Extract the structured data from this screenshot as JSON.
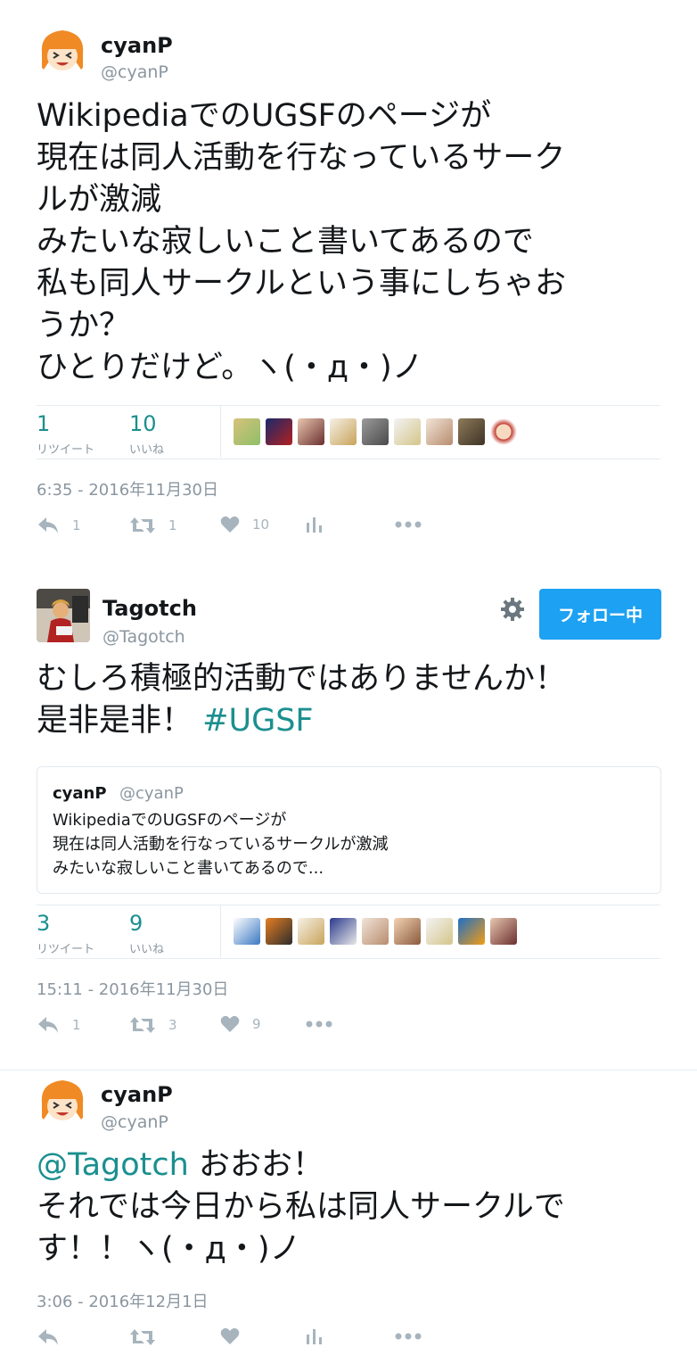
{
  "tweets": [
    {
      "name": "cyanP",
      "handle": "@cyanP",
      "body": "WikipediaでのUGSFのページが\n現在は同人活動を行なっているサーク\nルが激減\nみたいな寂しいこと書いてあるので\n私も同人サークルという事にしちゃお\nうか？\nひとりだけど。ヽ(・д・)ノ",
      "retweets_count": "1",
      "retweets_label": "リツイート",
      "likes_count": "10",
      "likes_label": "いいね",
      "timestamp": "6:35 - 2016年11月30日",
      "reply_count": "1",
      "retweet_count_action": "1",
      "like_count_action": "10"
    },
    {
      "name": "Tagotch",
      "handle": "@Tagotch",
      "follow_label": "フォロー中",
      "body_text": "むしろ積極的活動ではありませんか！\n是非是非！ ",
      "hashtag": "#UGSF",
      "quote": {
        "name": "cyanP",
        "handle": "@cyanP",
        "text": "WikipediaでのUGSFのページが\n現在は同人活動を行なっているサークルが激減\nみたいな寂しいこと書いてあるので..."
      },
      "retweets_count": "3",
      "retweets_label": "リツイート",
      "likes_count": "9",
      "likes_label": "いいね",
      "timestamp": "15:11 - 2016年11月30日",
      "reply_count": "1",
      "retweet_count_action": "3",
      "like_count_action": "9"
    },
    {
      "name": "cyanP",
      "handle": "@cyanP",
      "mention": "@Tagotch",
      "body_rest": " おおお！\nそれでは今日から私は同人サークルで\nす！！ヽ(・д・)ノ",
      "timestamp": "3:06 - 2016年12月1日"
    }
  ],
  "colors": {
    "accent": "#1b8f8f",
    "follow_button": "#1da1f2",
    "muted": "#8a96a0",
    "icon": "#a7b4bd"
  }
}
